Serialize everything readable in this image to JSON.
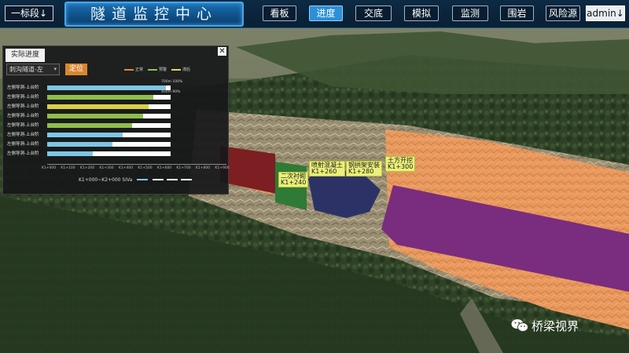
{
  "header": {
    "section_select": "一标段",
    "section_caret": "↓",
    "title": "隧道监控中心",
    "nav": [
      "看板",
      "进度",
      "交底",
      "模拟",
      "监测",
      "围岩",
      "风险源"
    ],
    "active_nav": "进度",
    "user": "admin",
    "user_caret": "↓"
  },
  "panel": {
    "tab_label": "实际进度",
    "close_icon": "✕",
    "tunnel_select": "刺沟隧道-左",
    "locate_button": "定位",
    "legend": [
      {
        "label": "正常",
        "color": "#e58a2c"
      },
      {
        "label": "预警",
        "color": "#8bc34a"
      },
      {
        "label": "滞后",
        "color": "#e6d84a"
      }
    ],
    "scale_notes": [
      "700m  100%",
      "400m  90%"
    ],
    "rows": [
      {
        "label": "左侧导洞-上台阶",
        "progress": 0.96,
        "color": "#7ec6e6"
      },
      {
        "label": "左侧导洞-上台阶",
        "progress": 0.86,
        "color": "#8fbd4a"
      },
      {
        "label": "左侧导洞-上台阶",
        "progress": 0.82,
        "color": "#d8d046"
      },
      {
        "label": "左侧导洞-上台阶",
        "progress": 0.78,
        "color": "#8fbd4a"
      },
      {
        "label": "左侧导洞-上台阶",
        "progress": 0.69,
        "color": "#8fbd4a"
      },
      {
        "label": "左侧导洞-上台阶",
        "progress": 0.61,
        "color": "#7ec6e6"
      },
      {
        "label": "左侧导洞-上台阶",
        "progress": 0.53,
        "color": "#7ec6e6"
      },
      {
        "label": "左侧导洞-上台阶",
        "progress": 0.37,
        "color": "#7ec6e6"
      }
    ],
    "axis_ticks": [
      "K1+000",
      "K1+100",
      "K1+200",
      "K1+300",
      "K1+400",
      "K1+500",
      "K1+600",
      "K1+700",
      "K1+800",
      "K1+900"
    ],
    "axis_caption": "K1+000~K2+000  SIVa"
  },
  "stages": [
    {
      "name": "二次衬砌",
      "mileage": "K1+240"
    },
    {
      "name": "喷射混凝土",
      "mileage": "K1+260"
    },
    {
      "name": "钢拱架安装",
      "mileage": "K1+280"
    },
    {
      "name": "土方开挖",
      "mileage": "K1+300"
    }
  ],
  "colors": {
    "lining": "#7c1e22",
    "shotcrete": "#2f7a35",
    "arch": "#2d3266",
    "excavation": "#7a2c7e",
    "rock": "#e9995d"
  },
  "watermark": {
    "icon": "wechat-icon",
    "text": "桥梁视界"
  }
}
